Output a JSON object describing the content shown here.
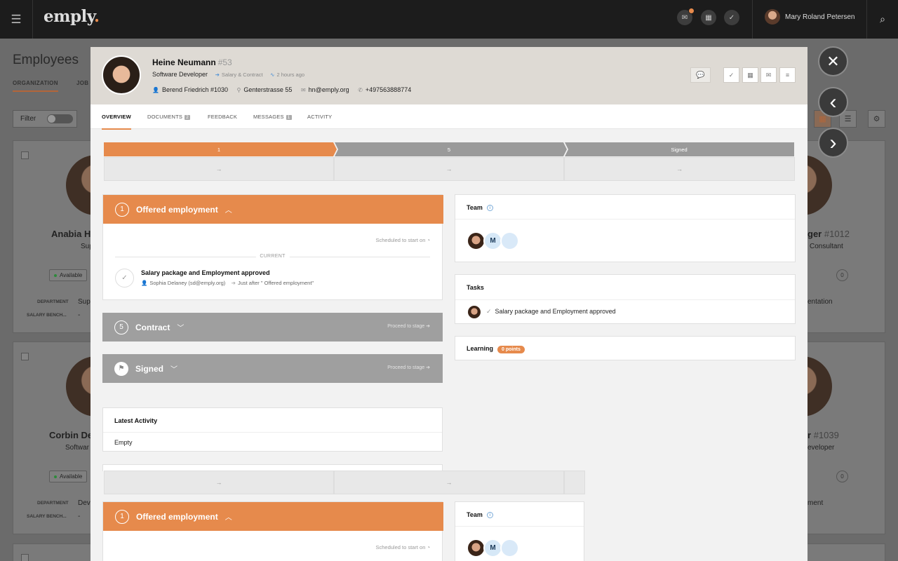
{
  "topbar": {
    "logo": "emply",
    "logo_dot": ".",
    "menu_icon": "hamburger-icon",
    "icons": [
      "mail-icon",
      "calendar-icon",
      "check-icon"
    ],
    "user_name": "Mary Roland Petersen",
    "search_icon": "search-icon"
  },
  "background": {
    "title": "Employees",
    "tabs": [
      "ORGANIZATION",
      "JOB"
    ],
    "filter_label": "Filter",
    "cards": [
      {
        "name": "Anabia H",
        "role": "Sup",
        "status": "Available",
        "dept_label": "DEPARTMENT",
        "dept_value": "Sup",
        "salary_label": "SALARY BENCH...",
        "salary_value": "-"
      },
      {
        "name": "Corbin De",
        "role": "Softwar",
        "status": "Available",
        "dept_label": "DEPARTMENT",
        "dept_value": "Dev",
        "salary_label": "SALARY BENCH...",
        "salary_value": "-"
      }
    ],
    "right_cards": [
      {
        "name": "ger",
        "num": "#1012",
        "role": "Consultant",
        "count": "0",
        "dept_value": "entation"
      },
      {
        "name": "r",
        "num": "#1039",
        "role": "eveloper",
        "count": "0",
        "dept_value": "ment"
      }
    ]
  },
  "nav": {
    "close": "✕",
    "prev": "‹",
    "next": "›"
  },
  "profile": {
    "name": "Heine Neumann",
    "id": "#53",
    "job": "Software Developer",
    "stage_meta": "Salary & Contract",
    "time_meta": "2 hours ago",
    "manager": "Berend Friedrich #1030",
    "address": "Genterstrasse 55",
    "email": "hn@emply.org",
    "phone": "+497563888774"
  },
  "tabs": [
    {
      "label": "OVERVIEW",
      "count": ""
    },
    {
      "label": "DOCUMENTS",
      "count": "2"
    },
    {
      "label": "FEEDBACK",
      "count": ""
    },
    {
      "label": "MESSAGES",
      "count": "1"
    },
    {
      "label": "ACTIVITY",
      "count": ""
    }
  ],
  "stages": [
    "1",
    "5",
    "Signed"
  ],
  "stage_arrow": "→",
  "offered": {
    "num": "1",
    "title": "Offered employment",
    "scheduled": "Scheduled to start on",
    "current_label": "CURRENT",
    "task_title": "Salary package and Employment approved",
    "task_assignee": "Sophia Delaney (sd@emply.org)",
    "task_timing": "Just after \" Offered employment\""
  },
  "contract": {
    "num": "5",
    "title": "Contract",
    "proceed": "Proceed to stage"
  },
  "signed": {
    "title": "Signed",
    "proceed": "Proceed to stage"
  },
  "team": {
    "title": "Team",
    "member_initial": "M"
  },
  "tasks": {
    "title": "Tasks",
    "item": "Salary package and Employment approved"
  },
  "learning": {
    "title": "Learning",
    "points": "0 points"
  },
  "latest_activity": {
    "title": "Latest Activity",
    "value": "Empty"
  }
}
